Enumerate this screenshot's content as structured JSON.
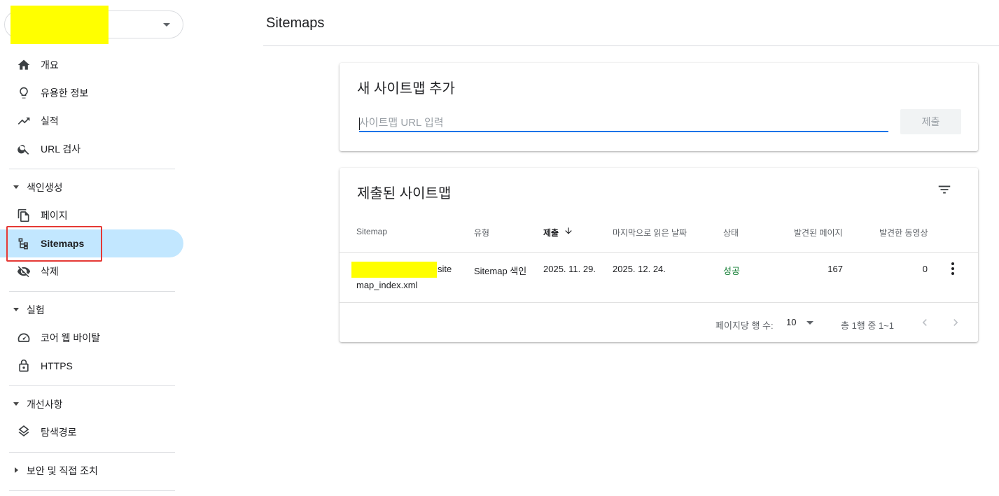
{
  "sidebar": {
    "property_selector": {
      "value": ""
    },
    "items": [
      {
        "label": "개요",
        "icon": "home-icon"
      },
      {
        "label": "유용한 정보",
        "icon": "lightbulb-icon"
      },
      {
        "label": "실적",
        "icon": "trending-up-icon"
      },
      {
        "label": "URL 검사",
        "icon": "search-icon"
      }
    ],
    "indexing": {
      "title": "색인생성",
      "items": [
        {
          "label": "페이지",
          "icon": "pages-icon"
        },
        {
          "label": "Sitemaps",
          "icon": "sitemap-icon",
          "active": true
        },
        {
          "label": "삭제",
          "icon": "visibility-off-icon"
        }
      ]
    },
    "experience": {
      "title": "실험",
      "items": [
        {
          "label": "코어 웹 바이탈",
          "icon": "speed-icon"
        },
        {
          "label": "HTTPS",
          "icon": "lock-icon"
        }
      ]
    },
    "enhancements": {
      "title": "개선사항",
      "items": [
        {
          "label": "탐색경로",
          "icon": "layers-icon"
        }
      ]
    },
    "security": {
      "title": "보안 및 직접 조치"
    }
  },
  "header": {
    "title": "Sitemaps"
  },
  "add_card": {
    "title": "새 사이트맵 추가",
    "input_placeholder": "사이트맵 URL 입력",
    "submit_label": "제출"
  },
  "submitted_card": {
    "title": "제출된 사이트맵",
    "columns": [
      "Sitemap",
      "유형",
      "제출",
      "마지막으로 읽은 날짜",
      "상태",
      "발견된 페이지",
      "발견한 동영상"
    ],
    "rows": [
      {
        "sitemap_suffix": "site",
        "sitemap_line2": "map_index.xml",
        "type": "Sitemap 색인",
        "submitted": "2025. 11. 29.",
        "last_read": "2025. 12. 24.",
        "status": "성공",
        "pages": "167",
        "videos": "0"
      }
    ],
    "pagination": {
      "rows_per_page_label": "페이지당 행 수:",
      "rows_per_page": "10",
      "range": "총 1행 중 1~1"
    }
  },
  "colors": {
    "accent": "#1a73e8",
    "active_nav": "#c2e7ff",
    "success": "#188038",
    "highlight": "#e53935",
    "redaction": "#ffff00"
  }
}
